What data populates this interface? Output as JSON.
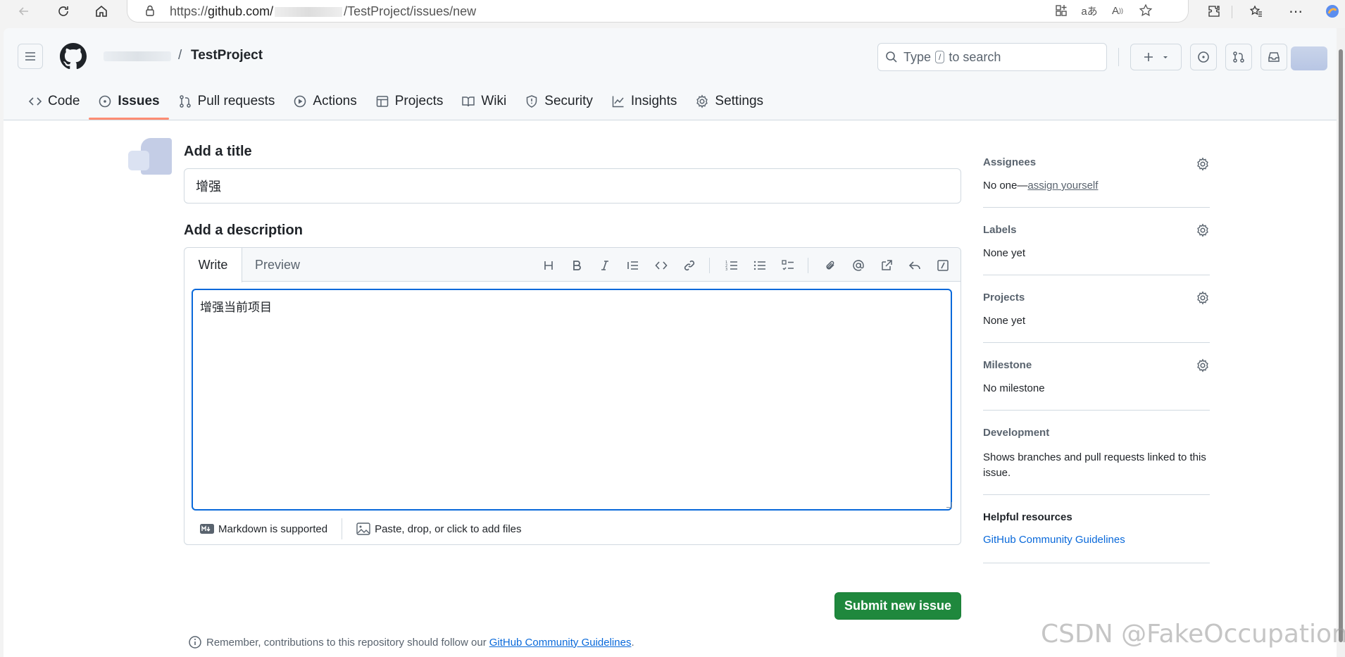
{
  "browser": {
    "url_prefix": "https://",
    "url_host": "github.com/",
    "url_path": "/TestProject/issues/new"
  },
  "header": {
    "repo_name": "TestProject",
    "crumb_separator": "/",
    "search_placeholder_before": "Type",
    "search_kbd": "/",
    "search_placeholder_after": "to search"
  },
  "repo_tabs": [
    {
      "label": "Code",
      "icon": "code-icon"
    },
    {
      "label": "Issues",
      "icon": "issue-opened-icon",
      "active": true
    },
    {
      "label": "Pull requests",
      "icon": "git-pull-request-icon"
    },
    {
      "label": "Actions",
      "icon": "play-icon"
    },
    {
      "label": "Projects",
      "icon": "table-icon"
    },
    {
      "label": "Wiki",
      "icon": "book-icon"
    },
    {
      "label": "Security",
      "icon": "shield-icon"
    },
    {
      "label": "Insights",
      "icon": "graph-icon"
    },
    {
      "label": "Settings",
      "icon": "gear-icon"
    }
  ],
  "form": {
    "title_heading": "Add a title",
    "title_value": "增强",
    "description_heading": "Add a description",
    "tab_write": "Write",
    "tab_preview": "Preview",
    "description_value": "增强当前项目",
    "markdown_note": "Markdown is supported",
    "attach_note": "Paste, drop, or click to add files",
    "submit_label": "Submit new issue",
    "remember_text": "Remember, contributions to this repository should follow our",
    "remember_link": "GitHub Community Guidelines",
    "remember_period": "."
  },
  "sidebar": {
    "assignees_title": "Assignees",
    "assignees_value": "No one—",
    "assign_yourself": "assign yourself",
    "labels_title": "Labels",
    "labels_value": "None yet",
    "projects_title": "Projects",
    "projects_value": "None yet",
    "milestone_title": "Milestone",
    "milestone_value": "No milestone",
    "development_title": "Development",
    "development_value": "Shows branches and pull requests linked to this issue.",
    "helpful_title": "Helpful resources",
    "helpful_link": "GitHub Community Guidelines"
  },
  "watermark": "CSDN @FakeOccupational",
  "colors": {
    "accent_blue": "#0969da",
    "submit_green": "#1f883d",
    "tab_underline": "#fd8c73"
  }
}
